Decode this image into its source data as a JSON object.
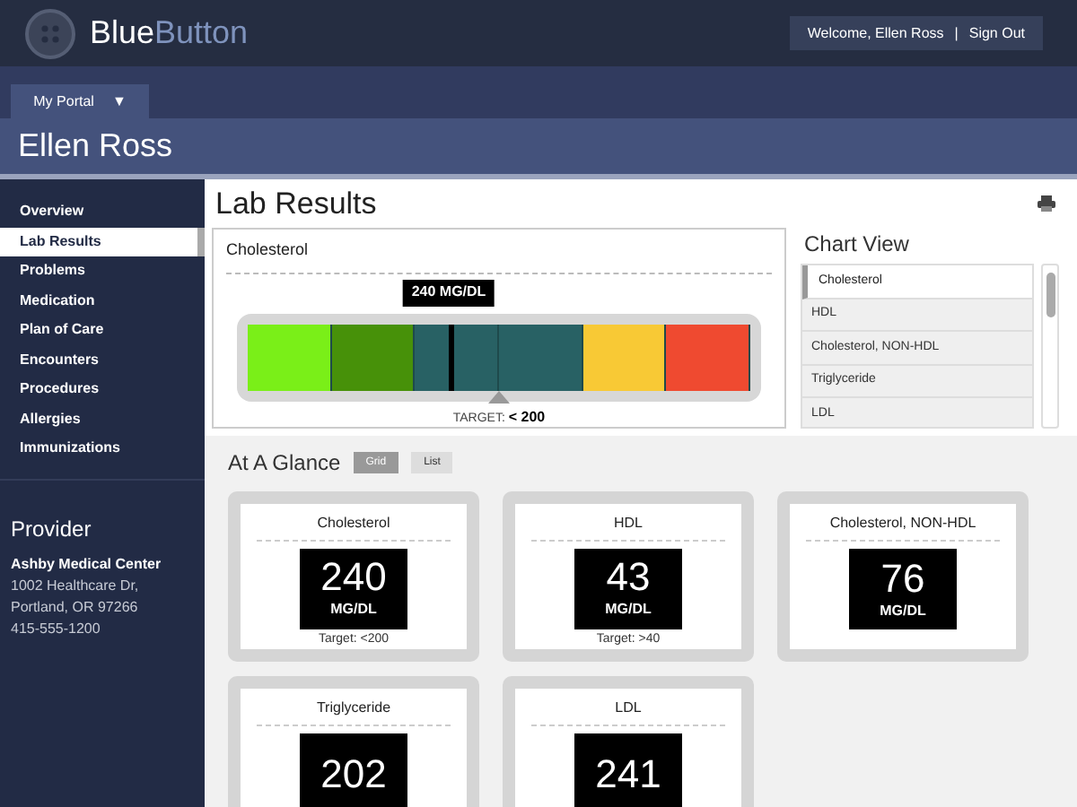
{
  "header": {
    "logo_bold": "Blue",
    "logo_light": "Button",
    "welcome": "Welcome, Ellen Ross",
    "separator": "|",
    "sign_out": "Sign Out"
  },
  "portal_tab": {
    "label": "My Portal",
    "caret": "▼"
  },
  "patient_name": "Ellen Ross",
  "sidebar": {
    "items": [
      {
        "label": "Overview",
        "selected": false
      },
      {
        "label": "Lab Results",
        "selected": true
      },
      {
        "label": "Problems",
        "selected": false
      },
      {
        "label": "Medication",
        "selected": false
      },
      {
        "label": "Plan of Care",
        "selected": false
      },
      {
        "label": "Encounters",
        "selected": false
      },
      {
        "label": "Procedures",
        "selected": false
      },
      {
        "label": "Allergies",
        "selected": false
      },
      {
        "label": "Immunizations",
        "selected": false
      }
    ],
    "provider": {
      "heading": "Provider",
      "name": "Ashby Medical Center",
      "address_1": "1002 Healthcare Dr,",
      "address_2": "Portland, OR 97266",
      "phone": "415-555-1200"
    }
  },
  "page_title": "Lab Results",
  "gauge": {
    "title": "Cholesterol",
    "reading": "240 MG/DL",
    "level": 0.4,
    "target_label": "TARGET:",
    "target_value": "< 200",
    "segments": [
      {
        "color": "#7aef18"
      },
      {
        "color": "#479109"
      },
      {
        "color": "#286164"
      },
      {
        "color": "#286164"
      },
      {
        "color": "#f8c935"
      },
      {
        "color": "#ef4a30"
      }
    ]
  },
  "chart_view": {
    "heading": "Chart View",
    "items": [
      {
        "label": "Cholesterol",
        "selected": true
      },
      {
        "label": "HDL",
        "selected": false
      },
      {
        "label": "Cholesterol, NON-HDL",
        "selected": false
      },
      {
        "label": "Triglyceride",
        "selected": false
      },
      {
        "label": "LDL",
        "selected": false
      }
    ]
  },
  "glance": {
    "heading": "At A Glance",
    "views": [
      {
        "label": "Grid",
        "selected": true
      },
      {
        "label": "List",
        "selected": false
      }
    ],
    "cards": [
      {
        "title": "Cholesterol",
        "value": "240",
        "unit": "MG/DL",
        "target": "Target: <200"
      },
      {
        "title": "HDL",
        "value": "43",
        "unit": "MG/DL",
        "target": "Target: >40"
      },
      {
        "title": "Cholesterol, NON-HDL",
        "value": "76",
        "unit": "MG/DL"
      },
      {
        "title": "Triglyceride",
        "value": "202"
      },
      {
        "title": "LDL",
        "value": "241"
      }
    ]
  }
}
